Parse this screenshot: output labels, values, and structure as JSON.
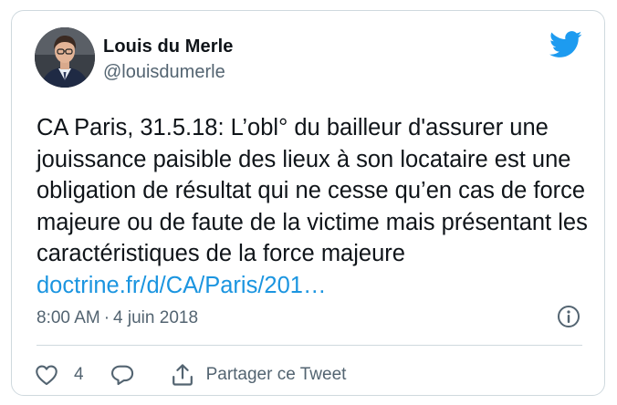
{
  "tweet": {
    "author": {
      "display_name": "Louis du Merle",
      "handle": "@louisdumerle"
    },
    "text_before_link": "CA Paris, 31.5.18: L’obl° du bailleur d'assurer une jouissance paisible des lieux à son locataire est une obligation de résultat qui ne cesse qu’en cas de force majeure ou de faute de la victime mais présentant les caractéristiques de la force majeure ",
    "link_text": "doctrine.fr/d/CA/Paris/201…",
    "time": "8:00 AM",
    "separator": "·",
    "date": "4 juin 2018"
  },
  "actions": {
    "like_count": "4",
    "share_label": "Partager ce Tweet"
  },
  "icons": {
    "brand": "twitter-bird-icon",
    "info": "info-icon",
    "like": "heart-icon",
    "reply": "reply-bubble-icon",
    "share": "share-icon"
  },
  "colors": {
    "brand_blue": "#1d9bf0",
    "link_blue": "#1b95e0",
    "text_primary": "#0f1419",
    "text_secondary": "#536471",
    "border": "#cfd9de"
  }
}
